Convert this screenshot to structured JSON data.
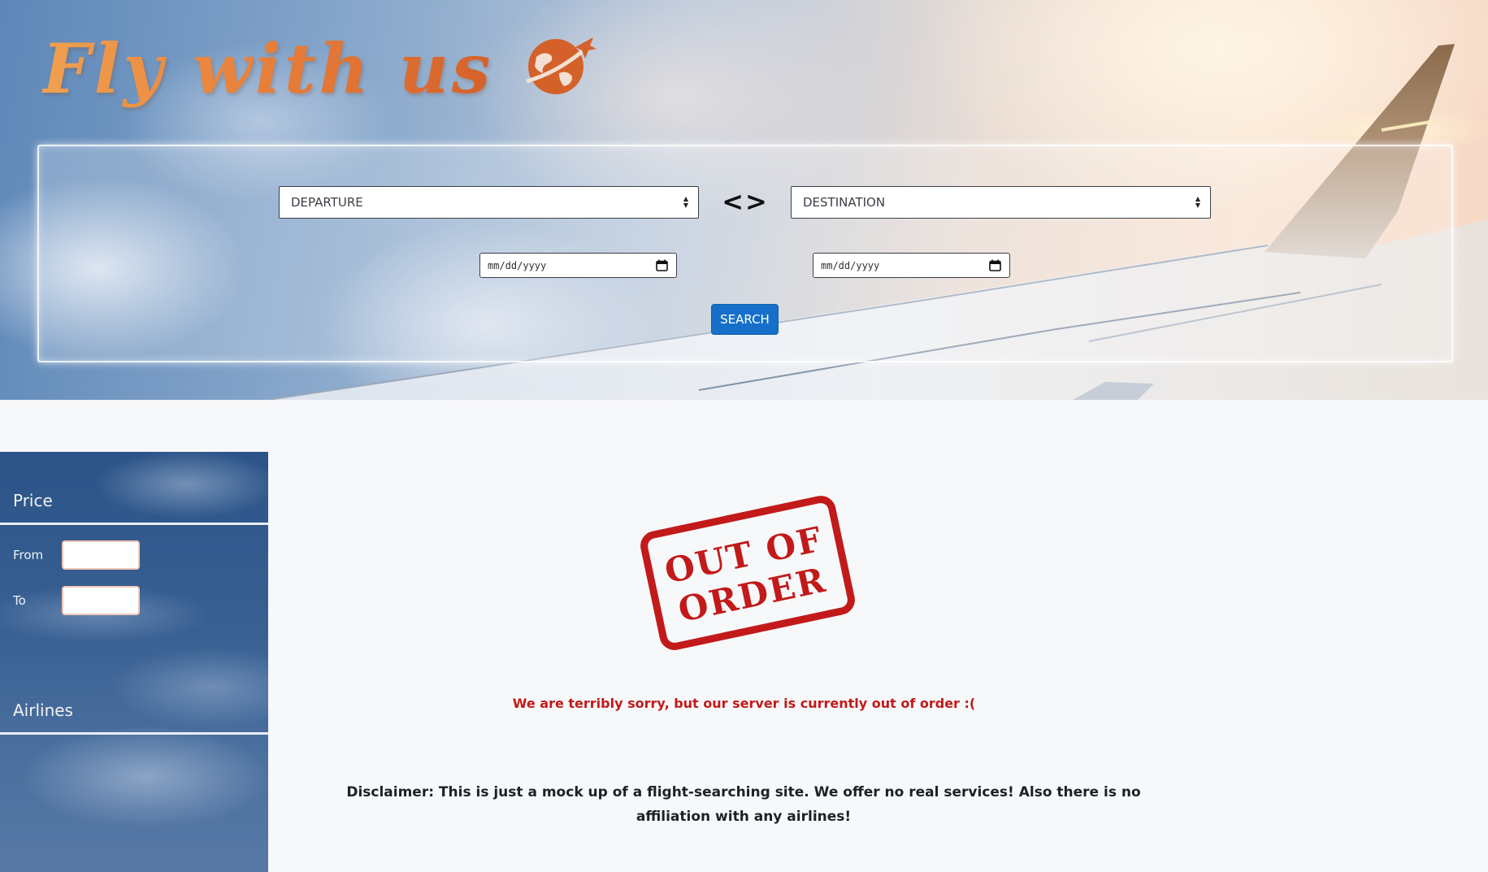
{
  "brand": {
    "logo_text": "Fly with us",
    "logo_icon": "globe-plane-icon",
    "logo_color": "#e8823c"
  },
  "search": {
    "departure_select": "DEPARTURE",
    "destination_select": "DESTINATION",
    "swap_symbol": "<>",
    "departure_date_placeholder": "mm/dd/yyyy",
    "return_date_placeholder": "mm/dd/yyyy",
    "search_button": "SEARCH",
    "button_color": "#1670c9"
  },
  "sidebar": {
    "price_heading": "Price",
    "from_label": "From",
    "to_label": "To",
    "from_value": "",
    "to_value": "",
    "airlines_heading": "Airlines"
  },
  "main": {
    "stamp_line1": "OUT OF",
    "stamp_line2": "ORDER",
    "stamp_color": "#c21a1a",
    "error_message": "We are terribly sorry, but our server is currently out of order :(",
    "disclaimer": "Disclaimer: This is just a mock up of a flight-searching site. We offer no real services! Also there is no affiliation with any airlines!"
  }
}
